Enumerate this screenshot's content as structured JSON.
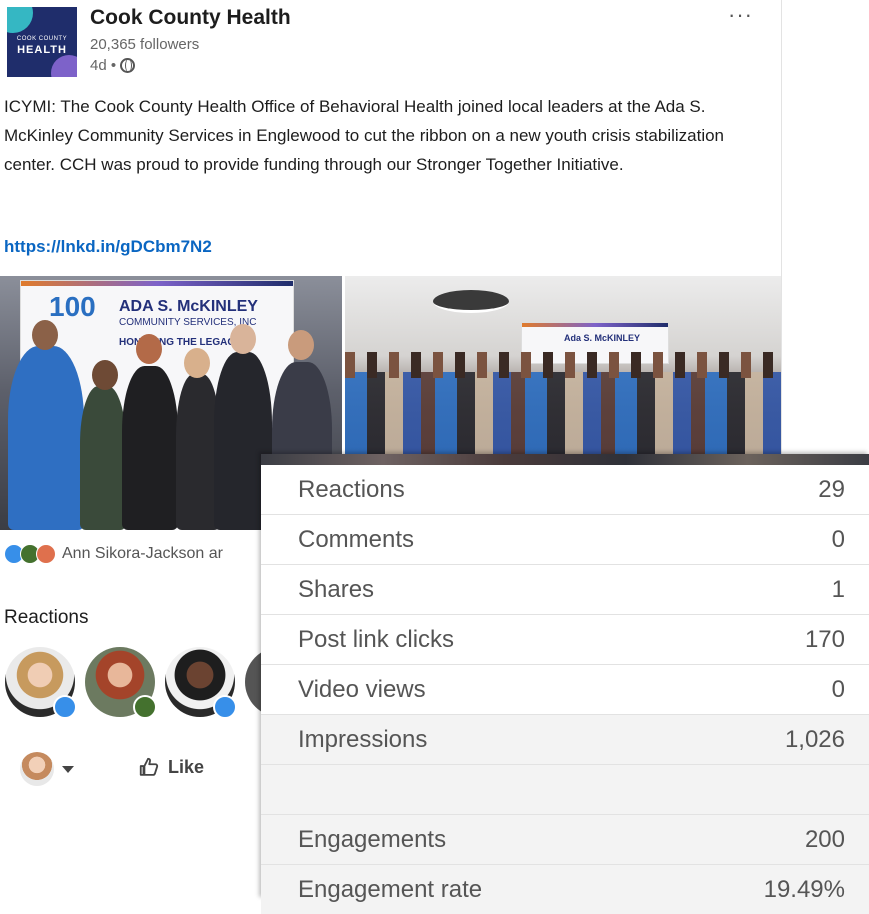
{
  "post": {
    "org_name": "Cook County Health",
    "followers": "20,365 followers",
    "age": "4d •",
    "more_label": "···",
    "logo_text_top": "COOK COUNTY",
    "logo_text_main": "HEALTH",
    "body": "ICYMI: The Cook County Health Office of Behavioral Health joined local leaders at the Ada S. McKinley Community Services in Englewood to cut the ribbon on a new youth crisis stabilization center. CCH was proud to provide funding through our Stronger Together Initiative.",
    "link": "https://lnkd.in/gDCbm7N2",
    "banner1_title": "ADA S. McKINLEY",
    "banner1_sub": "COMMUNITY SERVICES, INC",
    "banner1_tag": "HONORING THE LEGAC",
    "banner1_years": "100",
    "banner2_title": "Ada S. McKINLEY",
    "reactions_summary": "Ann Sikora-Jackson ar",
    "reactions_title": "Reactions",
    "like_label": "Like"
  },
  "stats": [
    {
      "label": "Reactions",
      "value": "29"
    },
    {
      "label": "Comments",
      "value": "0"
    },
    {
      "label": "Shares",
      "value": "1"
    },
    {
      "label": "Post link clicks",
      "value": "170"
    },
    {
      "label": "Video views",
      "value": "0"
    },
    {
      "label": "Impressions",
      "value": "1,026"
    },
    {
      "label": "",
      "value": ""
    },
    {
      "label": "Engagements",
      "value": "200"
    },
    {
      "label": "Engagement rate",
      "value": "19.49%"
    }
  ],
  "colors": {
    "link": "#0a66c2",
    "brand_navy": "#1f2d6b",
    "like_blue": "#378fe9",
    "celebrate_green": "#44712e",
    "love_red": "#df704d"
  },
  "icons": [
    "globe-icon",
    "like-icon",
    "celebrate-icon",
    "love-icon",
    "thumbs-up-icon",
    "caret-down-icon",
    "more-icon"
  ]
}
